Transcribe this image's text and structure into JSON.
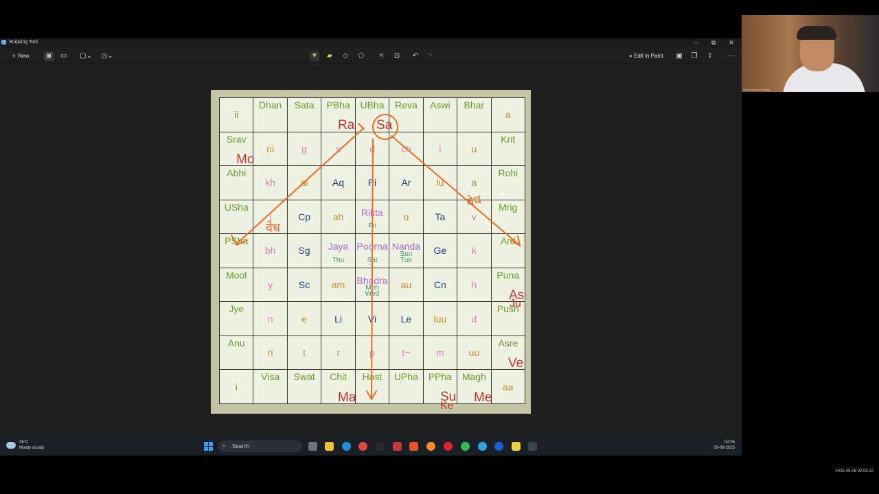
{
  "window": {
    "title": "Snipping Tool",
    "new_label": "New",
    "edit_in_paint_label": "Edit in Paint",
    "minimize": "–",
    "restore": "⧉",
    "close": "✕"
  },
  "toolbar_icons": [
    "camera-icon",
    "video-icon",
    "rectangle-mode-icon",
    "timer-icon",
    "ballpoint-pen-icon",
    "highlighter-icon",
    "eraser-icon",
    "shapes-icon",
    "crop-icon",
    "text-actions-icon",
    "undo-icon",
    "redo-icon",
    "save-icon",
    "copy-icon",
    "share-icon",
    "more-icon"
  ],
  "grid": {
    "rows": [
      [
        {
          "t": "ii",
          "c": "c-green"
        },
        {
          "t": "Dhan",
          "c": "c-green",
          "edge": true
        },
        {
          "t": "Sata",
          "c": "c-green",
          "edge": true
        },
        {
          "t": "PBha",
          "c": "c-green",
          "edge": true
        },
        {
          "t": "UBha",
          "c": "c-green",
          "edge": true
        },
        {
          "t": "Reva",
          "c": "c-green",
          "edge": true
        },
        {
          "t": "Aswi",
          "c": "c-green",
          "edge": true
        },
        {
          "t": "Bhar",
          "c": "c-green",
          "edge": true
        },
        {
          "t": "a",
          "c": "c-orange"
        }
      ],
      [
        {
          "t": "Srav",
          "c": "c-green",
          "edge": true
        },
        {
          "t": "rii",
          "c": "c-orange"
        },
        {
          "t": "g",
          "c": "c-pink"
        },
        {
          "t": "s",
          "c": "c-pink"
        },
        {
          "t": "d",
          "c": "c-pink"
        },
        {
          "t": "ch",
          "c": "c-pink"
        },
        {
          "t": "l",
          "c": "c-pink"
        },
        {
          "t": "u",
          "c": "c-orange"
        },
        {
          "t": "Krit",
          "c": "c-green",
          "edge": true
        }
      ],
      [
        {
          "t": "Abhi",
          "c": "c-green",
          "edge": true
        },
        {
          "t": "kh",
          "c": "c-pink"
        },
        {
          "t": "ai",
          "c": "c-orange"
        },
        {
          "t": "Aq",
          "c": "c-blue"
        },
        {
          "t": "Pi",
          "c": "c-blue"
        },
        {
          "t": "Ar",
          "c": "c-blue"
        },
        {
          "t": "lu",
          "c": "c-orange"
        },
        {
          "t": "a",
          "c": "c-orange"
        },
        {
          "t": "Rohi",
          "c": "c-green",
          "edge": true
        }
      ],
      [
        {
          "t": "USha",
          "c": "c-green",
          "edge": true
        },
        {
          "t": "j",
          "c": "c-pink"
        },
        {
          "t": "Cp",
          "c": "c-blue"
        },
        {
          "t": "ah",
          "c": "c-orange"
        },
        {
          "t": "Rikta",
          "c": "c-purple",
          "sub": "Fri",
          "subc": "c-teal",
          "top": true
        },
        {
          "t": "o",
          "c": "c-orange"
        },
        {
          "t": "Ta",
          "c": "c-blue"
        },
        {
          "t": "v",
          "c": "c-pink"
        },
        {
          "t": "Mrig",
          "c": "c-green",
          "edge": true
        }
      ],
      [
        {
          "t": "PSha",
          "c": "c-green",
          "edge": true
        },
        {
          "t": "bh",
          "c": "c-pink"
        },
        {
          "t": "Sg",
          "c": "c-blue"
        },
        {
          "t": "Jaya",
          "c": "c-purple",
          "sub": "Thu",
          "subc": "c-teal",
          "top": true
        },
        {
          "t": "Poorna",
          "c": "c-purple",
          "sub": "Sat",
          "subc": "c-teal",
          "top": true
        },
        {
          "t": "Nanda",
          "c": "c-purple",
          "sub": "Sun\nTue",
          "subc": "c-teal",
          "top": true
        },
        {
          "t": "Ge",
          "c": "c-blue"
        },
        {
          "t": "k",
          "c": "c-pink"
        },
        {
          "t": "Ard",
          "c": "c-green",
          "edge": true
        }
      ],
      [
        {
          "t": "Mool",
          "c": "c-green",
          "edge": true
        },
        {
          "t": "y",
          "c": "c-pink"
        },
        {
          "t": "Sc",
          "c": "c-blue"
        },
        {
          "t": "am",
          "c": "c-orange"
        },
        {
          "t": "Bhadra",
          "c": "c-purple",
          "sub": "Mon\nWed",
          "subc": "c-teal",
          "top": true
        },
        {
          "t": "au",
          "c": "c-orange"
        },
        {
          "t": "Cn",
          "c": "c-blue"
        },
        {
          "t": "h",
          "c": "c-pink"
        },
        {
          "t": "Puna",
          "c": "c-green",
          "edge": true
        }
      ],
      [
        {
          "t": "Jye",
          "c": "c-green",
          "edge": true
        },
        {
          "t": "n",
          "c": "c-pink"
        },
        {
          "t": "e",
          "c": "c-orange"
        },
        {
          "t": "Li",
          "c": "c-blue"
        },
        {
          "t": "Vi",
          "c": "c-blue"
        },
        {
          "t": "Le",
          "c": "c-blue"
        },
        {
          "t": "luu",
          "c": "c-orange"
        },
        {
          "t": "d",
          "c": "c-pink"
        },
        {
          "t": "Push",
          "c": "c-green",
          "edge": true
        }
      ],
      [
        {
          "t": "Anu",
          "c": "c-green",
          "edge": true
        },
        {
          "t": "ri",
          "c": "c-orange"
        },
        {
          "t": "t",
          "c": "c-pink"
        },
        {
          "t": "r",
          "c": "c-pink"
        },
        {
          "t": "p",
          "c": "c-pink"
        },
        {
          "t": "t~",
          "c": "c-pink"
        },
        {
          "t": "m",
          "c": "c-pink"
        },
        {
          "t": "uu",
          "c": "c-orange"
        },
        {
          "t": "Asre",
          "c": "c-green",
          "edge": true
        }
      ],
      [
        {
          "t": "i",
          "c": "c-green"
        },
        {
          "t": "Visa",
          "c": "c-green",
          "edge": true
        },
        {
          "t": "Swat",
          "c": "c-green",
          "edge": true
        },
        {
          "t": "Chit",
          "c": "c-green",
          "edge": true
        },
        {
          "t": "Hast",
          "c": "c-green",
          "edge": true
        },
        {
          "t": "UPha",
          "c": "c-green",
          "edge": true
        },
        {
          "t": "PPha",
          "c": "c-green",
          "edge": true
        },
        {
          "t": "Magh",
          "c": "c-green",
          "edge": true
        },
        {
          "t": "aa",
          "c": "c-orange"
        }
      ]
    ]
  },
  "planet_labels": {
    "ra": "Ra",
    "sa": "Sa",
    "mo": "Mo",
    "as": "As",
    "ju": "Ju",
    "ve": "Ve",
    "ma": "Ma",
    "su": "Su",
    "ke": "Ke",
    "me": "Me"
  },
  "handwriting": {
    "left": "वेध",
    "right": "वेध"
  },
  "taskbar": {
    "weather_temp": "25°C",
    "weather_desc": "Mostly cloudy",
    "search_label": "Search",
    "clock_time": "02:05",
    "clock_date": "06-09-2025"
  },
  "webcam": {
    "name": "Shubham Alock Singh"
  },
  "recording_timestamp": "2025-09-06 02:05:13",
  "colors": {
    "accent_orange": "#f26a1b",
    "planet_red": "#c8322c"
  }
}
